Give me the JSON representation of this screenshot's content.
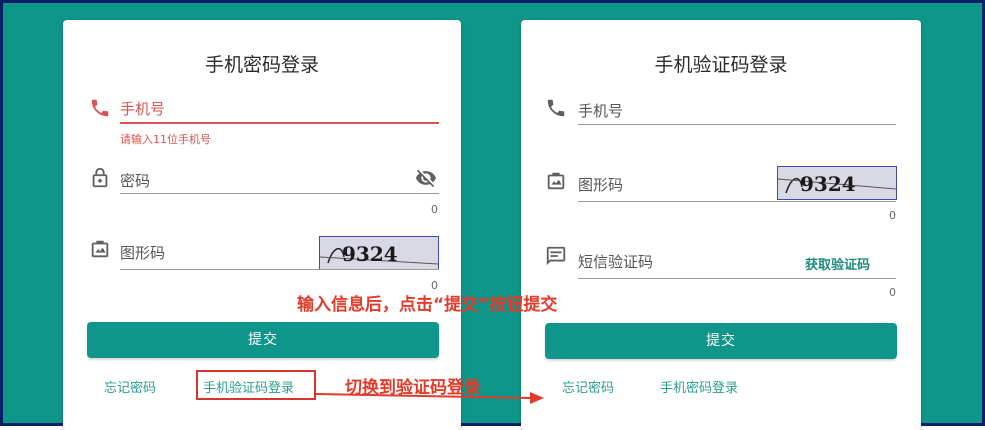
{
  "colors": {
    "brand": "#0f968a",
    "error": "#d9534f",
    "annotation": "#e23b2a",
    "frame_border": "#0a1f66"
  },
  "left_card": {
    "title": "手机密码登录",
    "phone": {
      "placeholder": "手机号",
      "error": "请输入11位手机号",
      "icon": "phone-icon"
    },
    "password": {
      "placeholder": "密码",
      "counter": "0",
      "icon": "lock-icon",
      "toggle_icon": "eye-off-icon"
    },
    "captcha": {
      "placeholder": "图形码",
      "counter": "0",
      "icon": "image-icon",
      "image_text": "9324"
    },
    "submit": "提交",
    "links": {
      "forgot": "忘记密码",
      "switch": "手机验证码登录"
    }
  },
  "right_card": {
    "title": "手机验证码登录",
    "phone": {
      "placeholder": "手机号",
      "icon": "phone-icon"
    },
    "captcha": {
      "placeholder": "图形码",
      "counter": "0",
      "icon": "image-icon",
      "image_text": "9324"
    },
    "sms": {
      "placeholder": "短信验证码",
      "send_label": "获取验证码",
      "counter": "0",
      "icon": "message-icon"
    },
    "submit": "提交",
    "links": {
      "forgot": "忘记密码",
      "switch": "手机密码登录"
    }
  },
  "annotations": {
    "submit_hint": "输入信息后，点击“提交”按钮提交",
    "switch_hint": "切换到验证码登录"
  }
}
